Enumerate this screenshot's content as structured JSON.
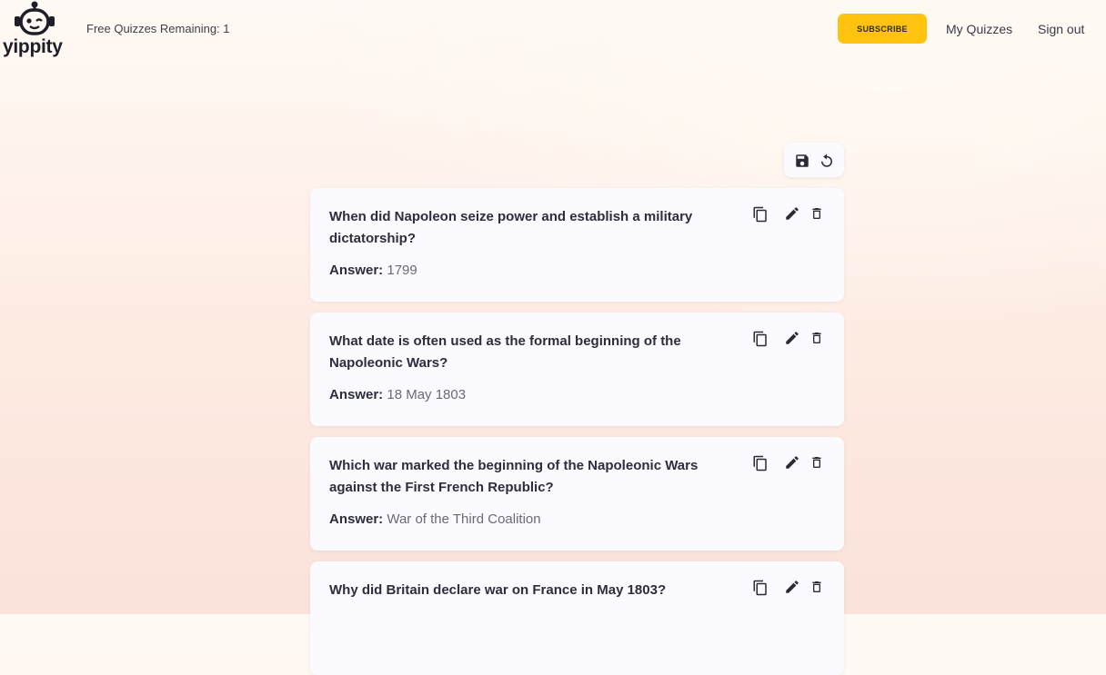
{
  "header": {
    "logo_text": "yippity",
    "quota_text": "Free Quizzes Remaining: 1",
    "subscribe_label": "SUBSCRIBE",
    "my_quizzes_label": "My Quizzes",
    "sign_out_label": "Sign out",
    "accent": "#ffc20e"
  },
  "toolbar": {
    "icons": [
      "save-icon",
      "undo-icon"
    ]
  },
  "answer_label": "Answer:",
  "card_icons": [
    "copy-icon",
    "edit-icon",
    "delete-icon"
  ],
  "cards": [
    {
      "question": "When did Napoleon seize power and establish a military dictatorship?",
      "answer": "1799"
    },
    {
      "question": "What date is often used as the formal beginning of the Napoleonic Wars?",
      "answer": "18 May 1803"
    },
    {
      "question": "Which war marked the beginning of the Napoleonic Wars against the First French Republic?",
      "answer": "War of the Third Coalition"
    },
    {
      "question": "Why did Britain declare war on France in May 1803?",
      "answer": ""
    }
  ]
}
